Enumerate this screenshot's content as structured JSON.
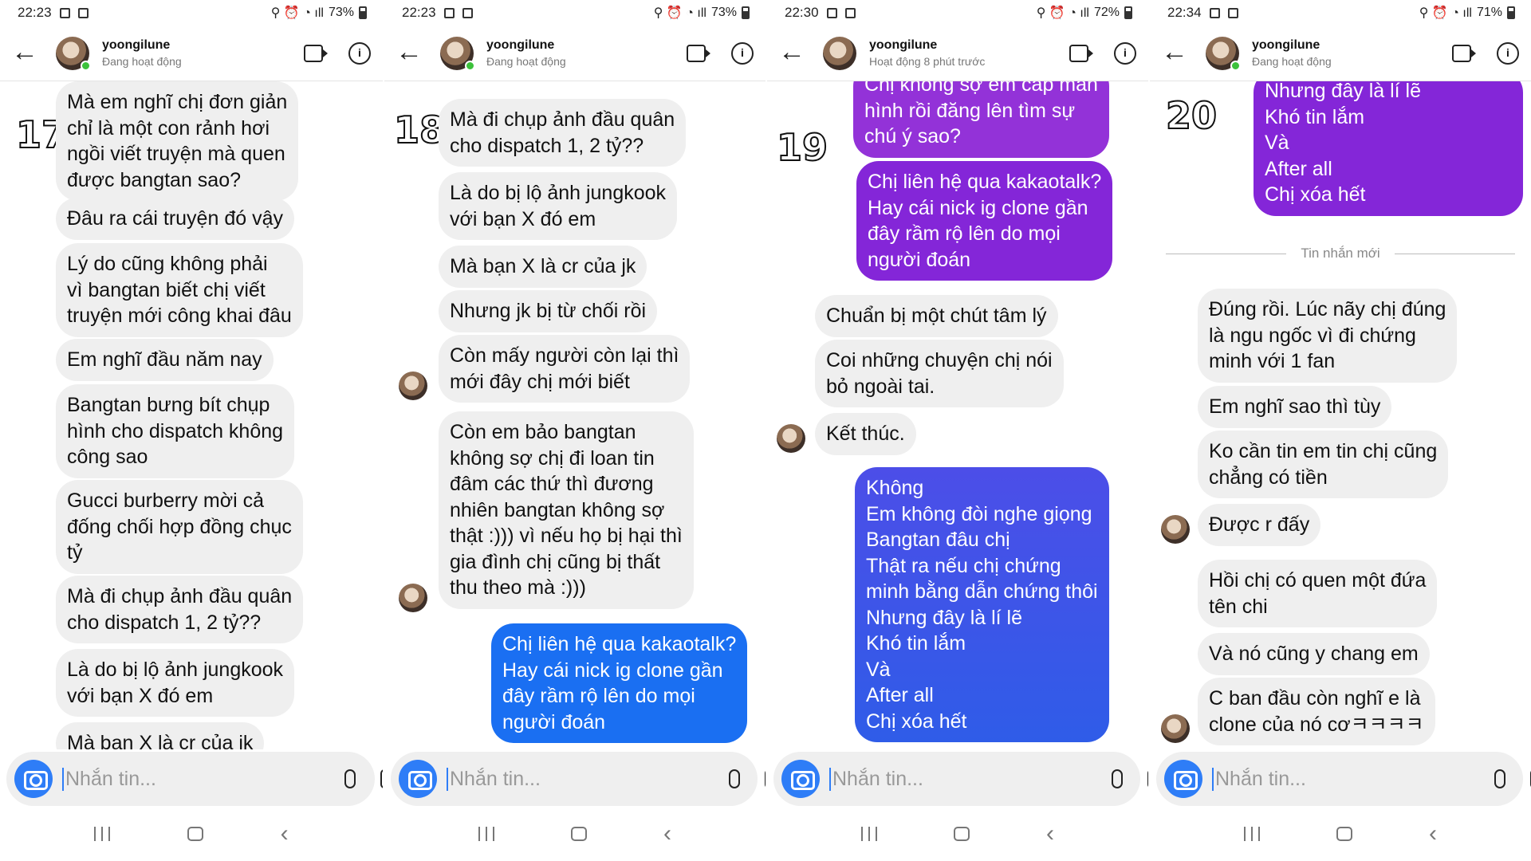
{
  "composer_placeholder": "Nhắn tin...",
  "contact_name": "yoongilune",
  "divider_label": "Tin nhắn mới",
  "panels": [
    {
      "time": "22:23",
      "battery": "73%",
      "status": "Đang hoạt động",
      "number": "17",
      "messages": [
        "Mà em nghĩ chị đơn giản\nchỉ là một con rảnh hơi\nngồi viết truyện mà quen\nđược bangtan sao?",
        "Đâu ra cái truyện đó vậy",
        "Lý do cũng không phải\nvì bangtan biết chị viết\ntruyện mới công khai đâu",
        "Em nghĩ đầu năm nay",
        "Bangtan bưng bít chụp\nhình cho dispatch không\ncông sao",
        "Gucci burberry mời cả\nđống chối hợp đồng chục\ntỷ",
        "Mà đi chụp ảnh đầu quân\ncho dispatch 1, 2 tỷ??",
        "Là do bị lộ ảnh jungkook\nvới bạn X đó em",
        "Mà bạn X là cr của jk"
      ]
    },
    {
      "time": "22:23",
      "battery": "73%",
      "status": "Đang hoạt động",
      "number": "18",
      "messages": [
        "Mà đi chụp ảnh đầu quân\ncho dispatch 1, 2 tỷ??",
        "Là do bị lộ ảnh jungkook\nvới bạn X đó em",
        "Mà bạn X là cr của jk",
        "Nhưng jk bị từ chối rồi",
        "Còn mấy người còn lại thì\nmới đây chị mới biết",
        "Còn em bảo bangtan\nkhông sợ chị đi loan tin\nđâm các thứ thì đương\nnhiên bangtan không sợ\nthật :))) vì nếu họ bị hại thì\ngia đình chị cũng bị thất\nthu theo mà :)))",
        "Chị liên hệ qua kakaotalk?\nHay cái nick ig clone gần\nđây rầm rộ lên do mọi\nngười đoán"
      ]
    },
    {
      "time": "22:30",
      "battery": "72%",
      "status": "Hoạt động 8 phút trước",
      "number": "19",
      "messages": [
        "Chị không sợ em cap màn\nhình rồi đăng lên tìm sự\nchú ý sao?",
        "Chị liên hệ qua kakaotalk?\nHay cái nick ig clone gần\nđây rầm rộ lên do mọi\nngười đoán",
        "Chuẩn bị một chút tâm lý",
        "Coi những chuyện chị nói\nbỏ ngoài tai.",
        "Kết thúc.",
        "Không\nEm không đòi nghe giọng\nBangtan đâu chị\nThật ra nếu chị chứng\nminh bằng dẫn chứng thôi\nNhưng đây là lí lẽ\nKhó tin lắm\nVà\nAfter all\nChị xóa hết"
      ]
    },
    {
      "time": "22:34",
      "battery": "71%",
      "status": "Đang hoạt động",
      "number": "20",
      "messages": [
        "Nhưng đây là lí lẽ\nKhó tin lắm\nVà\nAfter all\nChị xóa hết",
        "Đúng rồi. Lúc nãy chị đúng\nlà ngu ngốc vì đi chứng\nminh với 1 fan",
        "Em nghĩ sao thì tùy",
        "Ko cần tin em tin chị cũng\nchẳng có tiền",
        "Được r đấy",
        "Hồi chị có quen một đứa\ntên chi",
        "Và nó cũng y chang em",
        "C ban đầu  còn nghĩ e là\nclone của nó cơㅋㅋㅋㅋ"
      ]
    }
  ]
}
